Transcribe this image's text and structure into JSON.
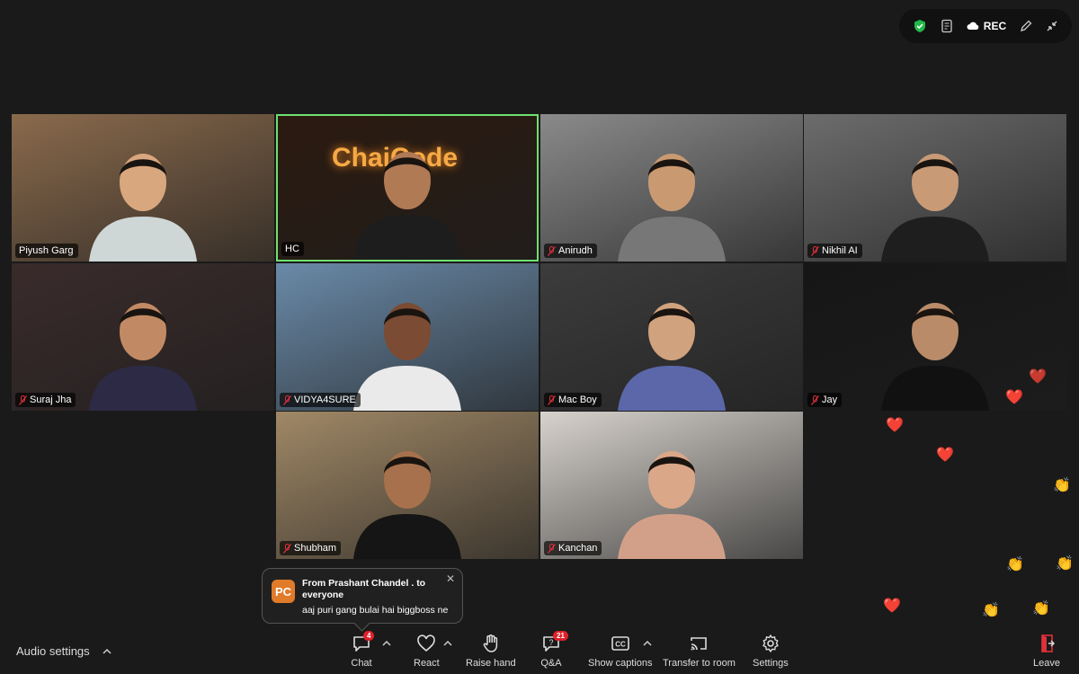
{
  "top_bar": {
    "rec_label": "REC"
  },
  "participants": [
    {
      "name": "Piyush Garg",
      "muted": false,
      "bg": "#8a6a4c",
      "shirt": "#cfd6d6",
      "skin": "#d9a77e"
    },
    {
      "name": "HC",
      "muted": false,
      "active": true,
      "bg": "#2b1a10",
      "shirt": "#1d1d1d",
      "skin": "#b07a55",
      "sign": "ChaiCode"
    },
    {
      "name": "Anirudh",
      "muted": true,
      "bg": "#8a8a8a",
      "shirt": "#777",
      "skin": "#c99a72"
    },
    {
      "name": "Nikhil AI",
      "muted": true,
      "bg": "#6c6c6c",
      "shirt": "#1e1e1e",
      "skin": "#c89a76"
    },
    {
      "name": "Suraj Jha",
      "muted": true,
      "bg": "#3a2b2b",
      "shirt": "#2c2a44",
      "skin": "#c28a64"
    },
    {
      "name": "VIDYA4SURE",
      "muted": true,
      "bg": "#6a8aa8",
      "shirt": "#eaeaea",
      "skin": "#7b4b34"
    },
    {
      "name": "Mac Boy",
      "muted": true,
      "bg": "#3c3c3c",
      "shirt": "#5b67a8",
      "skin": "#d1a27e"
    },
    {
      "name": "Jay",
      "muted": true,
      "bg": "#161616",
      "shirt": "#111",
      "skin": "#b98b69"
    },
    {
      "name": "Shubham",
      "muted": true,
      "bg": "#a08866",
      "shirt": "#151515",
      "skin": "#a7714d"
    },
    {
      "name": "Kanchan",
      "muted": true,
      "bg": "#d7d2cc",
      "shirt": "#d2a089",
      "skin": "#dba789"
    }
  ],
  "chat_toast": {
    "avatar_initials": "PC",
    "from_text": "From Prashant Chandel . to everyone",
    "message": "aaj puri gang bulai hai biggboss ne",
    "close_glyph": "✕"
  },
  "toolbar": {
    "audio_settings_label": "Audio settings",
    "chat": {
      "label": "Chat",
      "badge": "4"
    },
    "react": {
      "label": "React"
    },
    "raise_hand": {
      "label": "Raise hand"
    },
    "qa": {
      "label": "Q&A",
      "badge": "21"
    },
    "captions": {
      "label": "Show captions",
      "icon_text": "CC"
    },
    "transfer": {
      "label": "Transfer to room"
    },
    "settings": {
      "label": "Settings"
    },
    "leave": {
      "label": "Leave"
    }
  },
  "reactions": {
    "heart": "❤️",
    "clap": "👏"
  }
}
